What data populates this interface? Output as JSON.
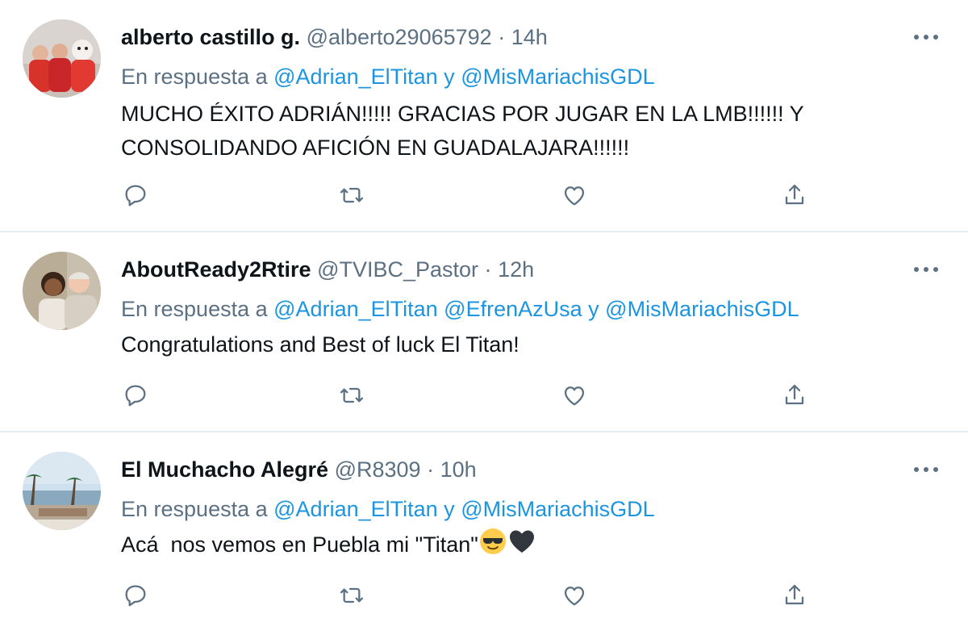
{
  "tweets": [
    {
      "name": "alberto castillo g.",
      "handle": "@alberto29065792",
      "time": "14h",
      "reply_prefix": "En respuesta a",
      "mentions": [
        "@Adrian_ElTitan",
        "@MisMariachisGDL"
      ],
      "conj": [
        "y"
      ],
      "text_lines": [
        "MUCHO ÉXITO ADRIÁN!!!!! GRACIAS POR JUGAR EN LA LMB!!!!!! Y",
        "CONSOLIDANDO AFICIÓN EN GUADALAJARA!!!!!!"
      ]
    },
    {
      "name": "AboutReady2Rtire",
      "handle": "@TVIBC_Pastor",
      "time": "12h",
      "reply_prefix": "En respuesta a",
      "mentions": [
        "@Adrian_ElTitan",
        "@EfrenAzUsa",
        "@MisMariachisGDL"
      ],
      "conj": [
        "y"
      ],
      "text_lines": [
        "Congratulations and Best of luck El Titan!"
      ]
    },
    {
      "name": "El Muchacho Alegré",
      "handle": "@R8309",
      "time": "10h",
      "reply_prefix": "En respuesta a",
      "mentions": [
        "@Adrian_ElTitan",
        "@MisMariachisGDL"
      ],
      "conj": [
        "y"
      ],
      "text_lines": [
        "Acá  nos vemos en Puebla mi \"Titan\""
      ],
      "emojis": [
        "smiling-face-with-sunglasses",
        "black-heart"
      ]
    }
  ],
  "separator": "·",
  "icons": [
    "reply-icon",
    "retweet-icon",
    "like-icon",
    "share-icon",
    "more-icon"
  ],
  "colors": {
    "mention": "#1b95e0",
    "meta": "#5b7083",
    "text": "#0f1419",
    "divider": "#e6ecf0"
  }
}
